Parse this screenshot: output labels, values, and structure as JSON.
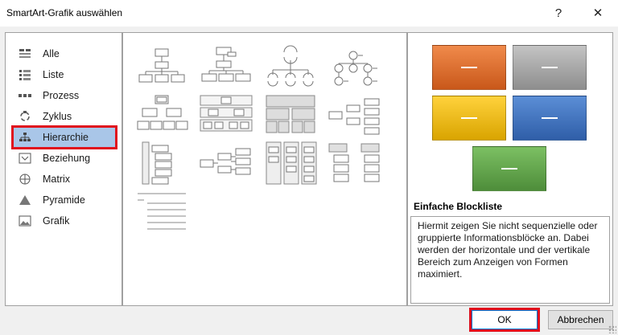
{
  "window": {
    "title": "SmartArt-Grafik auswählen",
    "help_glyph": "?",
    "close_glyph": "✕"
  },
  "categories": [
    {
      "label": "Alle",
      "icon": "all-layouts-icon",
      "selected": false
    },
    {
      "label": "Liste",
      "icon": "list-icon",
      "selected": false
    },
    {
      "label": "Prozess",
      "icon": "process-icon",
      "selected": false
    },
    {
      "label": "Zyklus",
      "icon": "cycle-icon",
      "selected": false
    },
    {
      "label": "Hierarchie",
      "icon": "hierarchy-icon",
      "selected": true
    },
    {
      "label": "Beziehung",
      "icon": "relationship-icon",
      "selected": false
    },
    {
      "label": "Matrix",
      "icon": "matrix-icon",
      "selected": false
    },
    {
      "label": "Pyramide",
      "icon": "pyramid-icon",
      "selected": false
    },
    {
      "label": "Grafik",
      "icon": "picture-icon",
      "selected": false
    }
  ],
  "layouts": [
    "organization-chart",
    "name-and-title-org-chart",
    "half-circle-org-chart",
    "circle-picture-hierarchy",
    "hierarchy",
    "labeled-hierarchy",
    "table-hierarchy",
    "horizontal-hierarchy",
    "hierarchy-list",
    "horizontal-multi-level-hierarchy",
    "architecture-layout",
    "lined-list-hierarchy",
    "text-hierarchy-lines"
  ],
  "preview": {
    "title": "Einfache Blockliste",
    "description": "Hiermit zeigen Sie nicht sequenzielle oder gruppierte Informationsblöcke an. Dabei werden der horizontale und der vertikale Bereich zum Anzeigen von Formen maximiert.",
    "colors": {
      "orange": "#e0702c",
      "gray": "#a6a6a6",
      "yellow": "#f2b800",
      "blue": "#4472c4",
      "green": "#63a84b"
    }
  },
  "buttons": {
    "ok": "OK",
    "cancel": "Abbrechen"
  },
  "highlight_color": "#e0101d"
}
